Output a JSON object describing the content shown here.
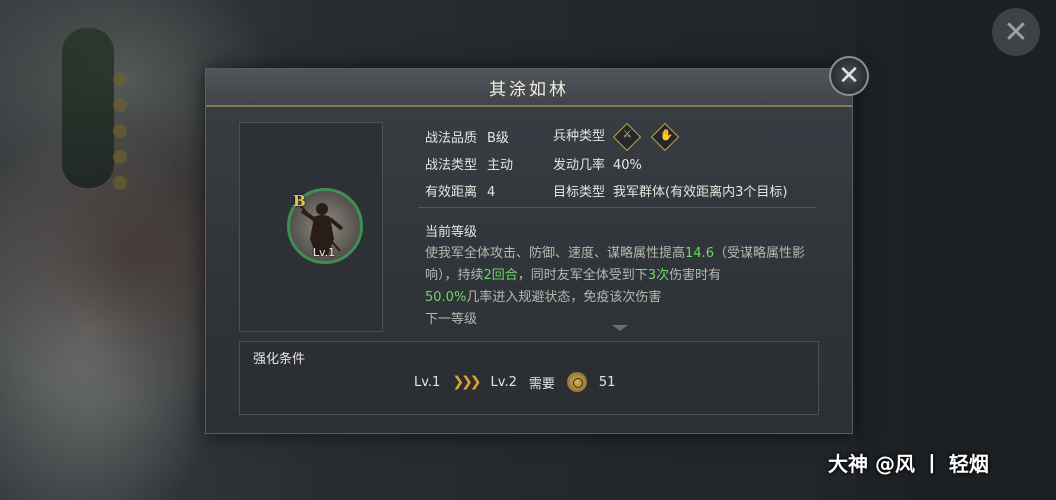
{
  "dialog": {
    "title": "其涂如林",
    "portrait": {
      "grade": "B",
      "level": "Lv.1"
    },
    "attributes": {
      "quality_label": "战法品质",
      "quality_value": "B级",
      "troop_label": "兵种类型",
      "type_label": "战法类型",
      "type_value": "主动",
      "rate_label": "发动几率",
      "rate_value": "40%",
      "range_label": "有效距离",
      "range_value": "4",
      "target_label": "目标类型",
      "target_value": "我军群体(有效距离内3个目标)"
    },
    "current_level_label": "当前等级",
    "description": {
      "p1": "使我军全体攻击、防御、速度、谋略属性提高",
      "v1": "14.6",
      "p2": "（受谋略属性影响），持续",
      "v2": "2回合",
      "p3": "，同时友军全体受到下",
      "v3": "3次",
      "p4": "伤害时有",
      "v4": "50.0%",
      "p5": "几率进入规避状态，免疫该次伤害"
    },
    "next_level_label": "下一等级",
    "upgrade": {
      "title": "强化条件",
      "from_level": "Lv.1",
      "to_level": "Lv.2",
      "need_label": "需要",
      "cost": "51"
    }
  },
  "watermark": "大神 @风 丨 轻烟",
  "colors": {
    "highlight": "#6fd66a",
    "accent_gold": "#e0a132",
    "grade": "#e9c34a"
  }
}
